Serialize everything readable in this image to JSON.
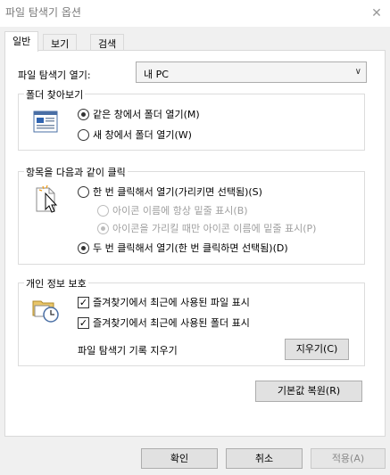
{
  "window": {
    "title": "파일 탐색기 옵션",
    "close_glyph": "✕"
  },
  "tabs": [
    {
      "label": "일반"
    },
    {
      "label": "보기"
    },
    {
      "label": "검색"
    }
  ],
  "general": {
    "open_label": "파일 탐색기 열기:",
    "open_value": "내 PC",
    "browse": {
      "legend": "폴더 찾아보기",
      "same_window": "같은 창에서 폴더 열기(M)",
      "new_window": "새 창에서 폴더 열기(W)"
    },
    "click": {
      "legend": "항목을 다음과 같이 클릭",
      "single_click": "한 번 클릭해서 열기(가리키면 선택됨)(S)",
      "underline_always": "아이콘 이름에 항상 밑줄 표시(B)",
      "underline_point": "아이콘을 가리킬 때만 아이콘 이름에 밑줄 표시(P)",
      "double_click": "두 번 클릭해서 열기(한 번 클릭하면 선택됨)(D)"
    },
    "privacy": {
      "legend": "개인 정보 보호",
      "recent_files": "즐겨찾기에서 최근에 사용된 파일 표시",
      "frequent_folders": "즐겨찾기에서 최근에 사용된 폴더 표시",
      "clear_label": "파일 탐색기 기록 지우기",
      "clear_button": "지우기(C)"
    },
    "restore_button": "기본값 복원(R)"
  },
  "footer": {
    "ok": "확인",
    "cancel": "취소",
    "apply": "적용(A)"
  }
}
